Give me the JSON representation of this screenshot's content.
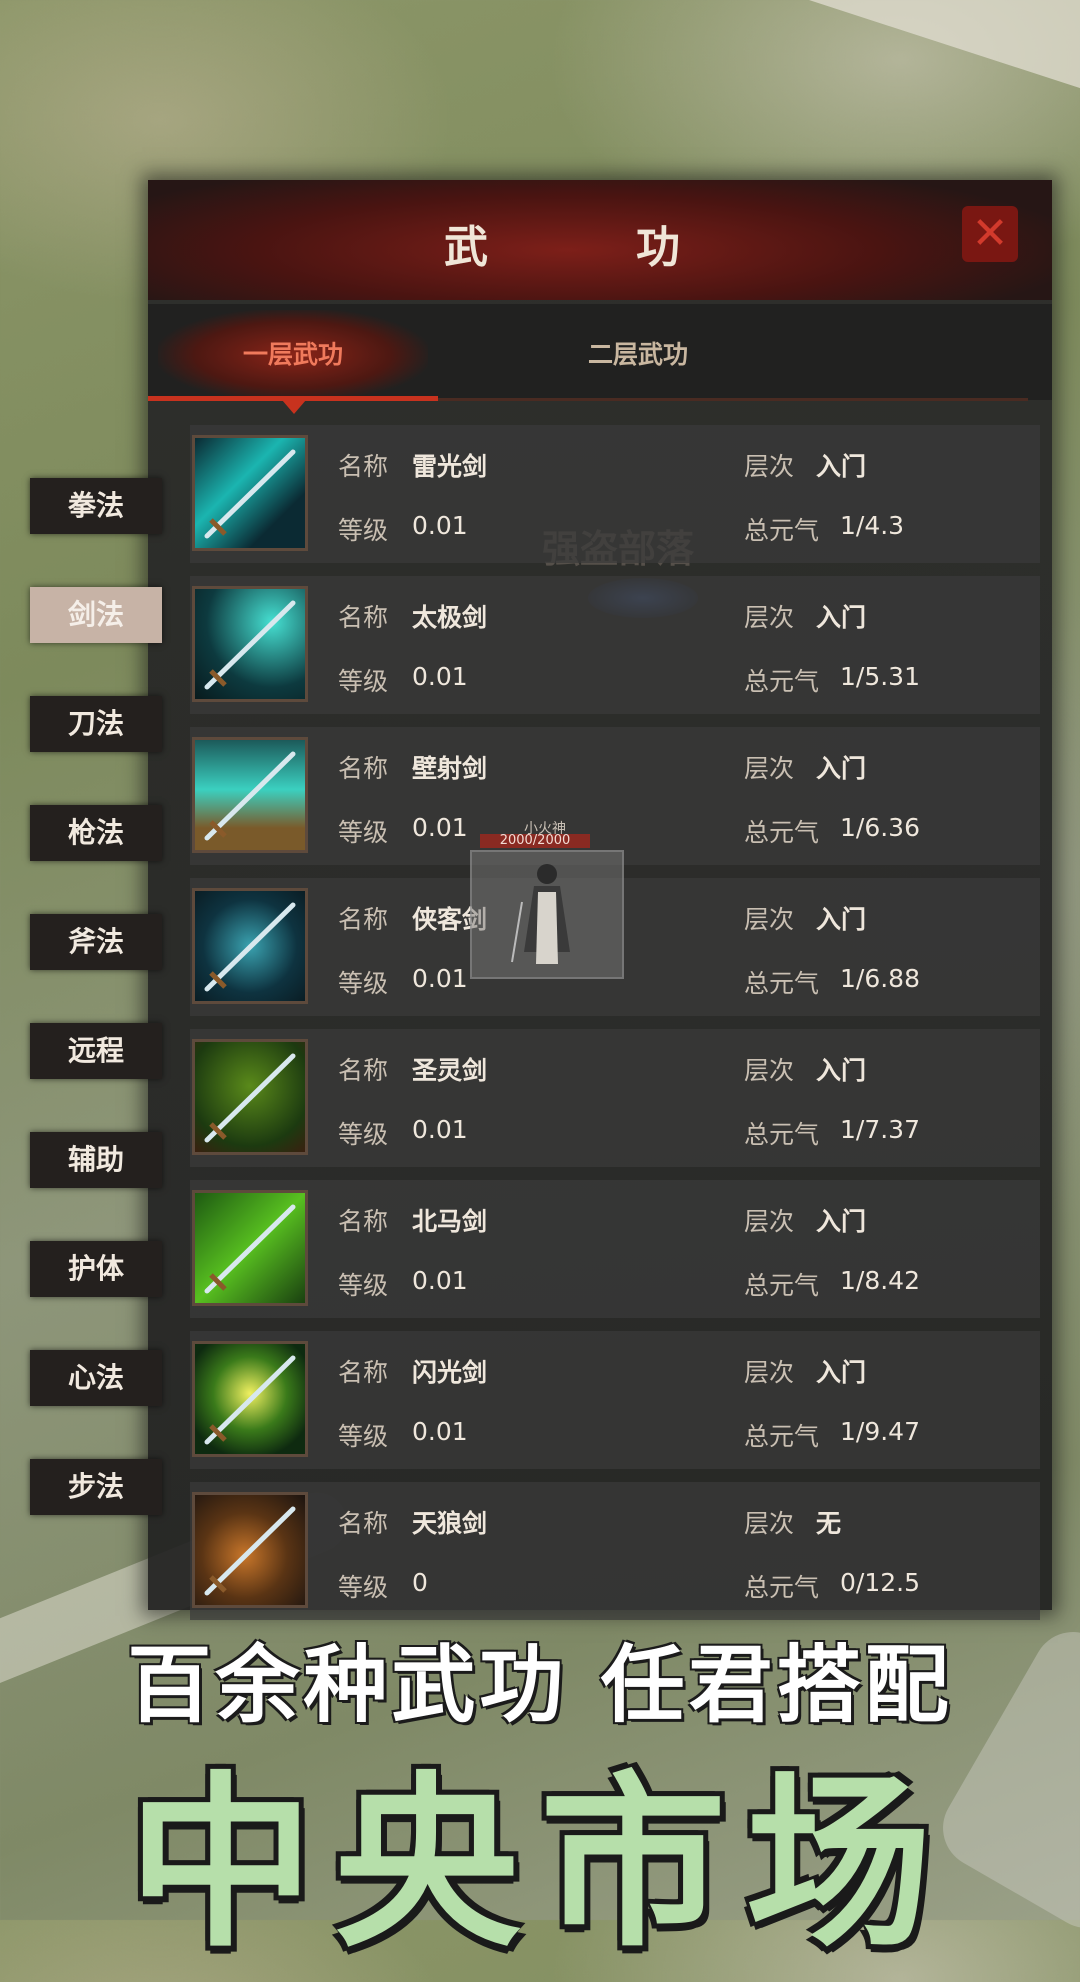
{
  "panel": {
    "title": "武　功",
    "tabs": [
      {
        "label": "一层武功",
        "active": true
      },
      {
        "label": "二层武功",
        "active": false
      }
    ]
  },
  "background_label": "强盗部落",
  "categories": [
    {
      "label": "拳法",
      "active": false
    },
    {
      "label": "剑法",
      "active": true
    },
    {
      "label": "刀法",
      "active": false
    },
    {
      "label": "枪法",
      "active": false
    },
    {
      "label": "斧法",
      "active": false
    },
    {
      "label": "远程",
      "active": false
    },
    {
      "label": "辅助",
      "active": false
    },
    {
      "label": "护体",
      "active": false
    },
    {
      "label": "心法",
      "active": false
    },
    {
      "label": "步法",
      "active": false
    }
  ],
  "labels": {
    "name": "名称",
    "level": "等级",
    "tier": "层次",
    "qi": "总元气"
  },
  "skills": [
    {
      "name": "雷光剑",
      "level": "0.01",
      "tier": "入门",
      "qi": "1/4.3",
      "icon": "lightning-sword-icon"
    },
    {
      "name": "太极剑",
      "level": "0.01",
      "tier": "入门",
      "qi": "1/5.31",
      "icon": "taiji-sword-icon"
    },
    {
      "name": "壁射剑",
      "level": "0.01",
      "tier": "入门",
      "qi": "1/6.36",
      "icon": "wall-shot-sword-icon"
    },
    {
      "name": "侠客剑",
      "level": "0.01",
      "tier": "入门",
      "qi": "1/6.88",
      "icon": "xiake-sword-icon"
    },
    {
      "name": "圣灵剑",
      "level": "0.01",
      "tier": "入门",
      "qi": "1/7.37",
      "icon": "holy-spirit-sword-icon"
    },
    {
      "name": "北马剑",
      "level": "0.01",
      "tier": "入门",
      "qi": "1/8.42",
      "icon": "north-horse-sword-icon"
    },
    {
      "name": "闪光剑",
      "level": "0.01",
      "tier": "入门",
      "qi": "1/9.47",
      "icon": "flash-sword-icon"
    },
    {
      "name": "天狼剑",
      "level": "0",
      "tier": "无",
      "qi": "0/12.5",
      "icon": "sky-wolf-sword-icon"
    }
  ],
  "character": {
    "name": "小火神",
    "hp": "2000/2000"
  },
  "slogan": "百余种武功 任君搭配",
  "big_title": "中央市场"
}
